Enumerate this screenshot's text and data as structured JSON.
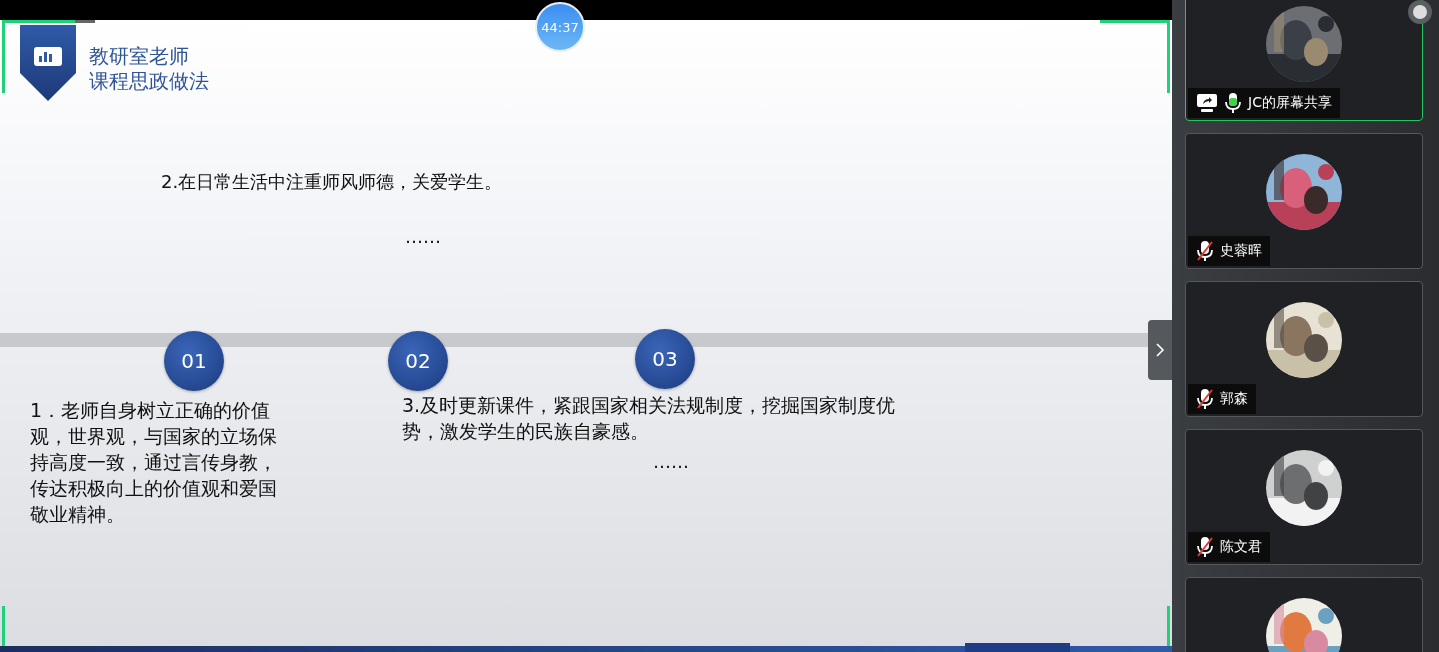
{
  "timer": "44:37",
  "slide": {
    "title_lines": [
      "教研室老师",
      "课程思政做法"
    ],
    "top_note": "2.在日常生活中注重师风师德，关爱学生。",
    "top_ellipsis": "……",
    "badges": [
      "01",
      "02",
      "03"
    ],
    "left_note": "1．老师自身树立正确的价值观，世界观，与国家的立场保持高度一致，通过言传身教，传达积极向上的价值观和爱国敬业精神。",
    "right_note": "3.及时更新课件，紧跟国家相关法规制度，挖掘国家制度优势，激发学生的民族自豪感。",
    "right_ellipsis": "……"
  },
  "participants": [
    {
      "name": "JC的屏幕共享",
      "sharing": true,
      "muted": false,
      "active": true
    },
    {
      "name": "史蓉晖",
      "sharing": false,
      "muted": true,
      "active": false
    },
    {
      "name": "郭森",
      "sharing": false,
      "muted": true,
      "active": false
    },
    {
      "name": "陈文君",
      "sharing": false,
      "muted": true,
      "active": false
    },
    {
      "active": false
    }
  ]
}
